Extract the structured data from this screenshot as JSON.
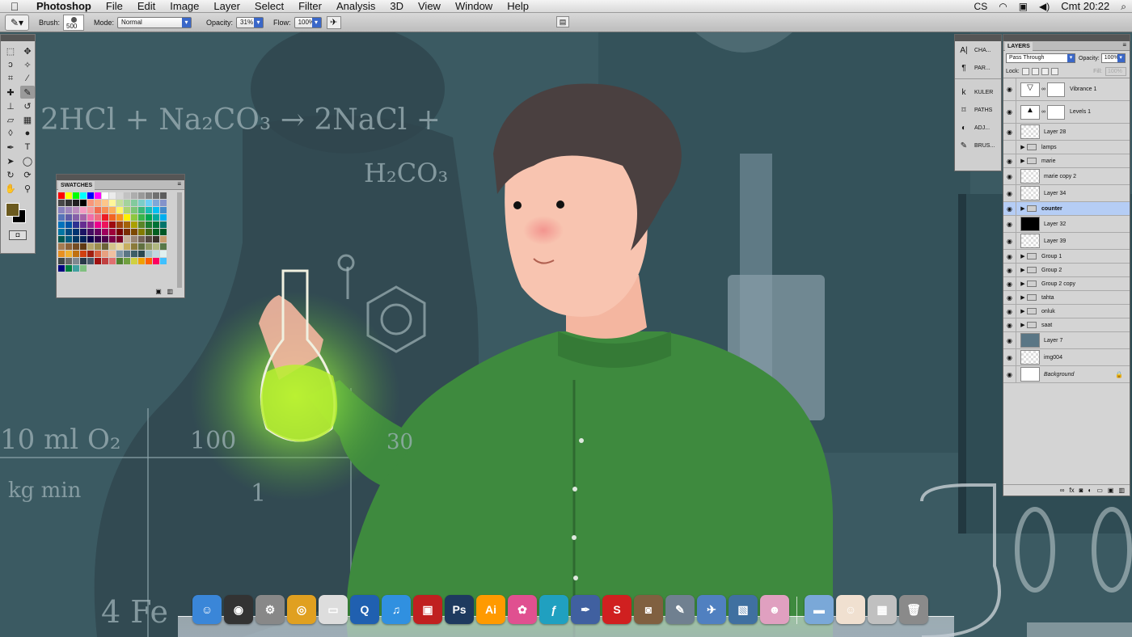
{
  "menubar": {
    "app_name": "Photoshop",
    "items": [
      "File",
      "Edit",
      "Image",
      "Layer",
      "Select",
      "Filter",
      "Analysis",
      "3D",
      "View",
      "Window",
      "Help"
    ],
    "status": {
      "cs": "CS",
      "clock": "Cmt 20:22"
    }
  },
  "options": {
    "brush_label": "Brush:",
    "brush_size": "500",
    "mode_label": "Mode:",
    "mode_value": "Normal",
    "opacity_label": "Opacity:",
    "opacity_value": "31%",
    "flow_label": "Flow:",
    "flow_value": "100%"
  },
  "swatches": {
    "title": "SWATCHES",
    "colors": [
      "#ff0000",
      "#ffff00",
      "#00ff00",
      "#00ffff",
      "#0000ff",
      "#ff00ff",
      "#ffffff",
      "#ebebeb",
      "#d6d6d6",
      "#c2c2c2",
      "#adadad",
      "#999999",
      "#858585",
      "#707070",
      "#5c5c5c",
      "#474747",
      "#333333",
      "#1f1f1f",
      "#000000",
      "#f7977a",
      "#f9ad81",
      "#fdc68a",
      "#fff79a",
      "#c4df9b",
      "#a3d39c",
      "#82ca9d",
      "#7bcdc8",
      "#6ecff6",
      "#7ea7d8",
      "#8493ca",
      "#8882be",
      "#a187be",
      "#bc8dbf",
      "#f49ac2",
      "#f6989d",
      "#f26c4f",
      "#f68e55",
      "#fbaf5c",
      "#fff467",
      "#acd372",
      "#7cc576",
      "#3bb878",
      "#1abbb4",
      "#00bff3",
      "#438cca",
      "#5574b9",
      "#605ca8",
      "#855fa8",
      "#a763a8",
      "#f06eaa",
      "#f26d7d",
      "#ed1c24",
      "#f26522",
      "#f7941d",
      "#fff200",
      "#8dc73f",
      "#39b54a",
      "#00a651",
      "#00a99d",
      "#00aeef",
      "#0072bc",
      "#0054a6",
      "#2e3192",
      "#662d91",
      "#92278f",
      "#ec008c",
      "#ed145b",
      "#9e0b0f",
      "#a0410d",
      "#a36209",
      "#aba000",
      "#598527",
      "#197b30",
      "#007236",
      "#00746b",
      "#0076a3",
      "#004b80",
      "#003471",
      "#1b1464",
      "#440e62",
      "#630460",
      "#9e005d",
      "#9e0039",
      "#790000",
      "#7b2e00",
      "#7d4900",
      "#827b00",
      "#406618",
      "#005e20",
      "#005826",
      "#005952",
      "#005b7f",
      "#003663",
      "#002157",
      "#0d004c",
      "#32004b",
      "#4b0049",
      "#7b0046",
      "#7a0026",
      "#c7b299",
      "#998675",
      "#736357",
      "#534741",
      "#37302a",
      "#c69c6d",
      "#a67c52",
      "#8c6239",
      "#754c24",
      "#603913",
      "#b5a46b",
      "#9c8c4e",
      "#6b6238",
      "#d4c58a",
      "#e8d8a0",
      "#c8b060",
      "#8a7a3a",
      "#607040",
      "#909860",
      "#b0b880",
      "#587848",
      "#e89020",
      "#f0b030",
      "#c07010",
      "#d04010",
      "#a02010",
      "#d86040",
      "#e8a080",
      "#f0c0a0",
      "#8098a8",
      "#5a7685",
      "#3e5e66",
      "#2a4850",
      "#a0c0c8",
      "#c0d8e0",
      "#e0f0f0",
      "#404848",
      "#686868",
      "#808890",
      "#283848",
      "#485868",
      "#a01010",
      "#c04040",
      "#e07070",
      "#508030",
      "#70a040",
      "#d0d040",
      "#f0a000",
      "#ff6000",
      "#ff0060",
      "#40c0ff",
      "#000080",
      "#008040",
      "#40a0a0",
      "#80c080"
    ]
  },
  "dock_panel": {
    "items": [
      {
        "icon": "character-icon",
        "glyph": "A|",
        "label": "CHA..."
      },
      {
        "icon": "paragraph-icon",
        "glyph": "¶",
        "label": "PAR..."
      },
      {
        "icon": "kuler-icon",
        "glyph": "k",
        "label": "KULER"
      },
      {
        "icon": "paths-icon",
        "glyph": "⌑",
        "label": "PATHS"
      },
      {
        "icon": "adjustments-icon",
        "glyph": "◐",
        "label": "ADJ..."
      },
      {
        "icon": "brushes-icon",
        "glyph": "✎",
        "label": "BRUS..."
      }
    ]
  },
  "layers_panel": {
    "title": "LAYERS",
    "blend_mode": "Pass Through",
    "opacity_label": "Opacity:",
    "opacity_value": "100%",
    "lock_label": "Lock:",
    "fill_label": "Fill:",
    "fill_value": "100%",
    "layers": [
      {
        "name": "Vibrance 1",
        "kind": "adjustment",
        "visible": true,
        "thumb": "vibrance"
      },
      {
        "name": "Levels 1",
        "kind": "adjustment",
        "visible": true,
        "thumb": "levels"
      },
      {
        "name": "Layer 28",
        "kind": "layer",
        "visible": true,
        "thumb": "transparent"
      },
      {
        "name": "lamps",
        "kind": "group",
        "visible": false
      },
      {
        "name": "marie",
        "kind": "group",
        "visible": true
      },
      {
        "name": "marie copy 2",
        "kind": "layer",
        "visible": true,
        "thumb": "figure"
      },
      {
        "name": "Layer 34",
        "kind": "layer",
        "visible": true,
        "thumb": "transparent"
      },
      {
        "name": "counter",
        "kind": "group",
        "visible": true,
        "selected": true
      },
      {
        "name": "Layer 32",
        "kind": "layer",
        "visible": true,
        "thumb": "black"
      },
      {
        "name": "Layer 39",
        "kind": "layer",
        "visible": true,
        "thumb": "transparent"
      },
      {
        "name": "Group 1",
        "kind": "group",
        "visible": true
      },
      {
        "name": "Group 2",
        "kind": "group",
        "visible": true
      },
      {
        "name": "Group 2 copy",
        "kind": "group",
        "visible": true
      },
      {
        "name": "tahta",
        "kind": "group",
        "visible": true
      },
      {
        "name": "onluk",
        "kind": "group",
        "visible": true
      },
      {
        "name": "saat",
        "kind": "group",
        "visible": true
      },
      {
        "name": "Layer 7",
        "kind": "layer",
        "visible": true,
        "thumb": "slate"
      },
      {
        "name": "img004",
        "kind": "smart",
        "visible": true,
        "thumb": "transparent"
      },
      {
        "name": "Background",
        "kind": "background",
        "visible": true,
        "thumb": "white",
        "locked": true
      }
    ]
  },
  "canvas": {
    "chalk_text": {
      "eq1": "2HCl  +  Na₂CO₃  →  2NaCl  +",
      "eq2": "H₂CO₃",
      "note1": "10 ml O₂",
      "note2": "100",
      "note3": "kg  min",
      "note4": "4 Fe",
      "note5": "30",
      "note6": "1"
    }
  },
  "dock": {
    "apps": [
      {
        "name": "finder",
        "glyph": "☺",
        "color": "#3a86d8"
      },
      {
        "name": "dashboard",
        "glyph": "◉",
        "color": "#333333"
      },
      {
        "name": "system-preferences",
        "glyph": "⚙",
        "color": "#888888"
      },
      {
        "name": "chrome",
        "glyph": "◎",
        "color": "#e0a020"
      },
      {
        "name": "notes",
        "glyph": "▭",
        "color": "#dddddd"
      },
      {
        "name": "quicktime",
        "glyph": "Q",
        "color": "#2060b0"
      },
      {
        "name": "itunes",
        "glyph": "♫",
        "color": "#3090e0"
      },
      {
        "name": "photo-booth",
        "glyph": "▣",
        "color": "#c02020"
      },
      {
        "name": "photoshop",
        "glyph": "Ps",
        "color": "#1e3a5f"
      },
      {
        "name": "illustrator",
        "glyph": "Ai",
        "color": "#ff9a00"
      },
      {
        "name": "picasa",
        "glyph": "✿",
        "color": "#e05090"
      },
      {
        "name": "flash",
        "glyph": "ƒ",
        "color": "#20a0c0"
      },
      {
        "name": "pen-app",
        "glyph": "✒",
        "color": "#4060a0"
      },
      {
        "name": "sbp-app",
        "glyph": "S",
        "color": "#d02020"
      },
      {
        "name": "image-capture",
        "glyph": "◙",
        "color": "#806040"
      },
      {
        "name": "script-editor",
        "glyph": "✎",
        "color": "#708090"
      },
      {
        "name": "preview",
        "glyph": "✈",
        "color": "#5080c0"
      },
      {
        "name": "iphoto",
        "glyph": "▧",
        "color": "#4070a0"
      },
      {
        "name": "widget",
        "glyph": "☻",
        "color": "#e0a0c0"
      },
      {
        "name": "folder",
        "glyph": "▬",
        "color": "#7aa8d8"
      },
      {
        "name": "avatar-doc",
        "glyph": "☺",
        "color": "#f0e0d0"
      },
      {
        "name": "photos-stack",
        "glyph": "▦",
        "color": "#c0c0c0"
      },
      {
        "name": "trash",
        "glyph": "🗑",
        "color": "#8a8a8a"
      }
    ]
  }
}
